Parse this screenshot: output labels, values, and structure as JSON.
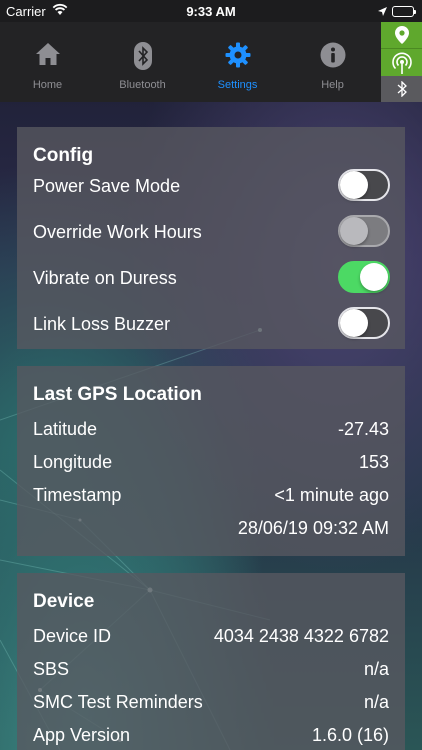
{
  "status_bar": {
    "carrier": "Carrier",
    "time": "9:33 AM"
  },
  "tabs": [
    {
      "label": "Home",
      "icon": "home-icon",
      "active": false
    },
    {
      "label": "Bluetooth",
      "icon": "bluetooth-icon",
      "active": false
    },
    {
      "label": "Settings",
      "icon": "gear-icon",
      "active": true
    },
    {
      "label": "Help",
      "icon": "info-icon",
      "active": false
    }
  ],
  "indicators": {
    "gps": {
      "icon": "location-pin-icon",
      "color": "#5fa82d"
    },
    "signal": {
      "icon": "signal-broadcast-icon",
      "color": "#5fa82d"
    },
    "bluetooth": {
      "icon": "bluetooth-icon",
      "color": "#5a5a5e"
    }
  },
  "config": {
    "title": "Config",
    "items": [
      {
        "label": "Power Save Mode",
        "state": "off"
      },
      {
        "label": "Override Work Hours",
        "state": "disabled"
      },
      {
        "label": "Vibrate on Duress",
        "state": "on"
      },
      {
        "label": "Link Loss Buzzer",
        "state": "off"
      }
    ]
  },
  "gps": {
    "title": "Last GPS Location",
    "latitude_label": "Latitude",
    "latitude": "-27.43",
    "longitude_label": "Longitude",
    "longitude": "153",
    "timestamp_label": "Timestamp",
    "timestamp": "<1 minute ago",
    "datetime": "28/06/19 09:32 AM"
  },
  "device": {
    "title": "Device",
    "device_id_label": "Device ID",
    "device_id": "4034 2438 4322 6782",
    "sbs_label": "SBS",
    "sbs": "n/a",
    "smc_label": "SMC Test Reminders",
    "smc": "n/a",
    "app_version_label": "App Version",
    "app_version": "1.6.0 (16)"
  },
  "colors": {
    "accent": "#1e90ff",
    "toggle_on": "#4cd964",
    "indicator_green": "#5fa82d"
  }
}
